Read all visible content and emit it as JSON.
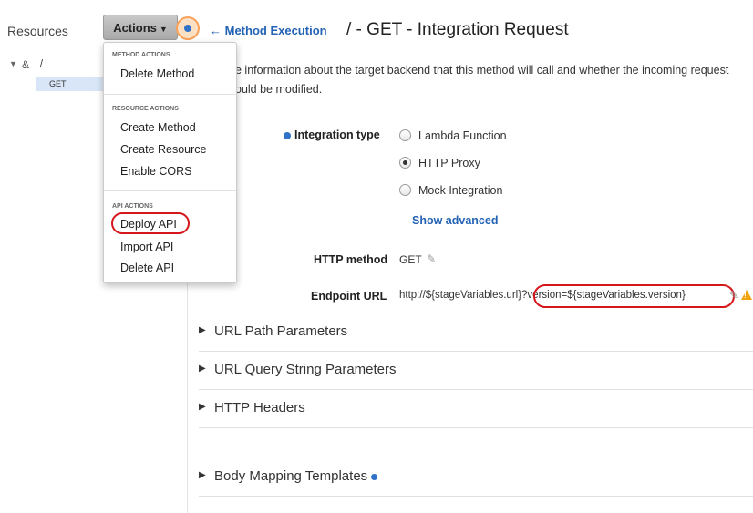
{
  "header": {
    "resources_label": "Resources",
    "actions_label": "Actions",
    "method_execution_link": "Method Execution",
    "page_title": "/ - GET - Integration Request"
  },
  "tree": {
    "root_label": "/",
    "method_label": "GET"
  },
  "actions_menu": {
    "sections": [
      {
        "header": "METHOD ACTIONS",
        "items": [
          "Delete Method"
        ]
      },
      {
        "header": "RESOURCE ACTIONS",
        "items": [
          "Create Method",
          "Create Resource",
          "Enable CORS"
        ]
      },
      {
        "header": "API ACTIONS",
        "items": [
          "Deploy API",
          "Import API",
          "Delete API"
        ]
      }
    ]
  },
  "description": {
    "line1": "e information about the target backend that this method will call and whether the incoming request",
    "line2": "ould be modified."
  },
  "integration": {
    "type_label": "Integration type",
    "options": [
      {
        "label": "Lambda Function",
        "selected": false
      },
      {
        "label": "HTTP Proxy",
        "selected": true
      },
      {
        "label": "Mock Integration",
        "selected": false
      }
    ],
    "show_advanced": "Show advanced",
    "http_method_label": "HTTP method",
    "http_method_value": "GET",
    "endpoint_label": "Endpoint URL",
    "endpoint_value": "http://${stageVariables.url}?version=${stageVariables.version}"
  },
  "sections": [
    {
      "title": "URL Path Parameters",
      "has_dot": false
    },
    {
      "title": "URL Query String Parameters",
      "has_dot": false
    },
    {
      "title": "HTTP Headers",
      "has_dot": false
    },
    {
      "title": "Body Mapping Templates",
      "has_dot": true
    }
  ],
  "colors": {
    "link": "#2463b4",
    "highlight_ring": "#d5161a",
    "info_dot": "#2f72c7",
    "warning": "#f0a30a"
  },
  "icons": {
    "pencil": "✎",
    "tree_caret": "▼",
    "section_caret": "▶",
    "back_arrow": "←",
    "resource_icon": "&"
  }
}
